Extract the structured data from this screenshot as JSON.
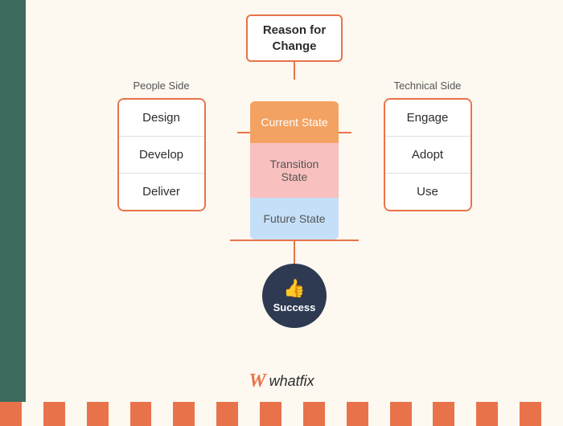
{
  "page": {
    "background": "#fdf8f0",
    "sidebar_color": "#3d6b5e"
  },
  "header": {
    "title_line1": "Reason for",
    "title_line2": "Change"
  },
  "people_side": {
    "label": "People Side",
    "items": [
      "Design",
      "Develop",
      "Deliver"
    ]
  },
  "states": {
    "current": "Current State",
    "transition": "Transition State",
    "future": "Future State"
  },
  "technical_side": {
    "label": "Technical Side",
    "items": [
      "Engage",
      "Adopt",
      "Use"
    ]
  },
  "success": {
    "label": "Success",
    "icon": "👍"
  },
  "logo": {
    "brand": "whatfix",
    "w_symbol": "𝓦"
  },
  "colors": {
    "orange": "#e8734a",
    "dark_navy": "#2d3a52",
    "green_sidebar": "#3d6b5e",
    "current_state_bg": "#f4a261",
    "transition_state_bg": "#f9c0c0",
    "future_state_bg": "#c5dff8"
  }
}
